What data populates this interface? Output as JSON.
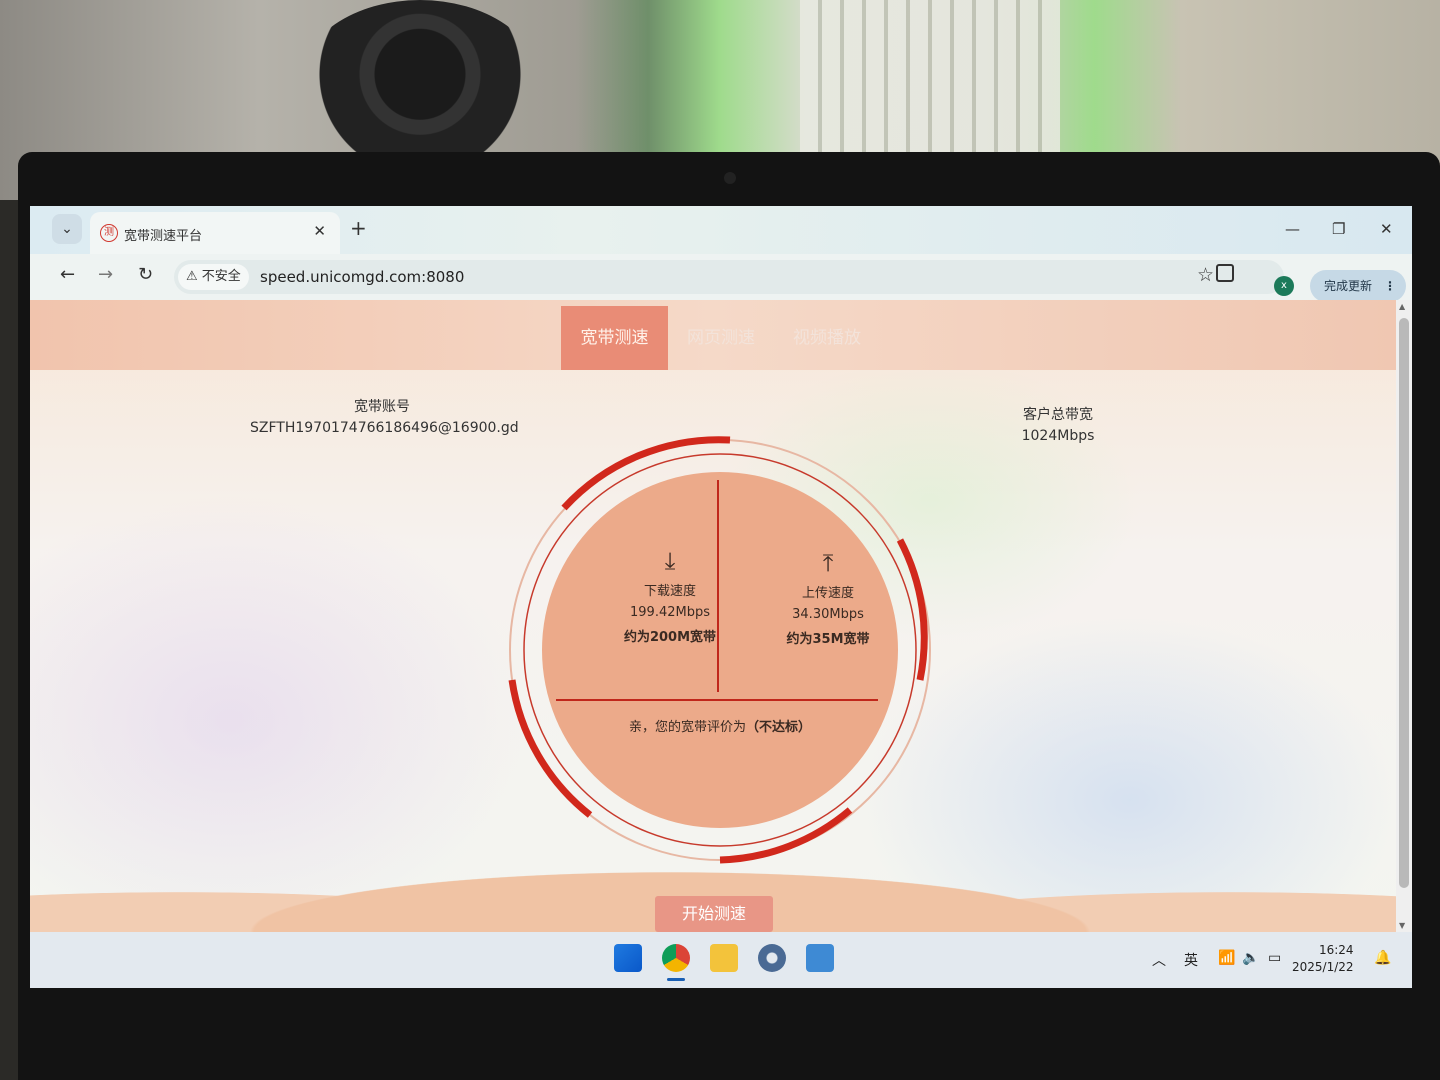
{
  "browser": {
    "tab_title": "宽带测速平台",
    "tab_favicon": "测",
    "security_label": "不安全",
    "url": "speed.unicomgd.com:8080",
    "update_label": "完成更新",
    "profile_initial": "x"
  },
  "page": {
    "nav_tabs": [
      {
        "label": "宽带测速",
        "active": true
      },
      {
        "label": "网页测速",
        "active": false
      },
      {
        "label": "视频播放",
        "active": false
      }
    ],
    "account_label": "宽带账号",
    "account_value": "SZFTH1970174766186496@16900.gd",
    "bandwidth_label": "客户总带宽",
    "bandwidth_value": "1024Mbps",
    "download": {
      "label": "下载速度",
      "value": "199.42Mbps",
      "approx": "约为200M宽带",
      "icon": "download-icon"
    },
    "upload": {
      "label": "上传速度",
      "value": "34.30Mbps",
      "approx": "约为35M宽带",
      "icon": "upload-icon"
    },
    "evaluation_prefix": "亲，您的宽带评价为",
    "evaluation_result": "（不达标）",
    "start_button": "开始测速"
  },
  "taskbar": {
    "ime": "英",
    "time": "16:24",
    "date": "2025/1/22"
  },
  "colors": {
    "accent_red": "#d1281c",
    "tab_active": "#e98c76",
    "gauge_fill": "#ecaa8a"
  }
}
